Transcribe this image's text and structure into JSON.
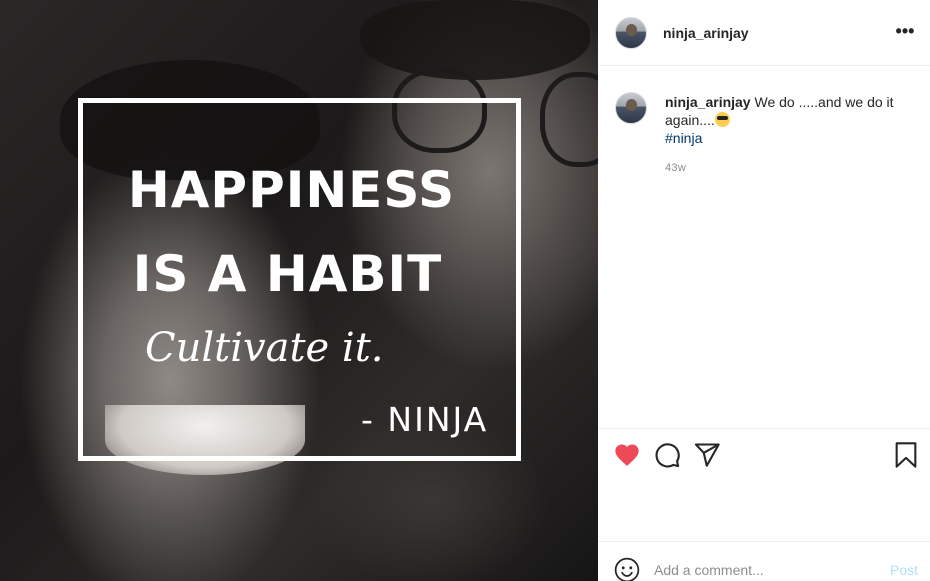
{
  "post": {
    "username": "ninja_arinjay",
    "image_quote": {
      "line1": "HAPPINESS",
      "line2": "IS A HABIT",
      "line3": "Cultivate it.",
      "line4": "- NINJA"
    }
  },
  "caption": {
    "username": "ninja_arinjay",
    "text": "We do .....and we do it again....",
    "hashtag": "#ninja",
    "timestamp": "43w"
  },
  "actions": {
    "like_icon": "heart-filled-icon",
    "comment_icon": "speech-bubble-icon",
    "share_icon": "paper-plane-icon",
    "save_icon": "bookmark-icon",
    "like_color": "#ed4956"
  },
  "comment_box": {
    "placeholder": "Add a comment...",
    "post_label": "Post",
    "post_color": "#b2dffc"
  },
  "header": {
    "more_label": "•••"
  }
}
